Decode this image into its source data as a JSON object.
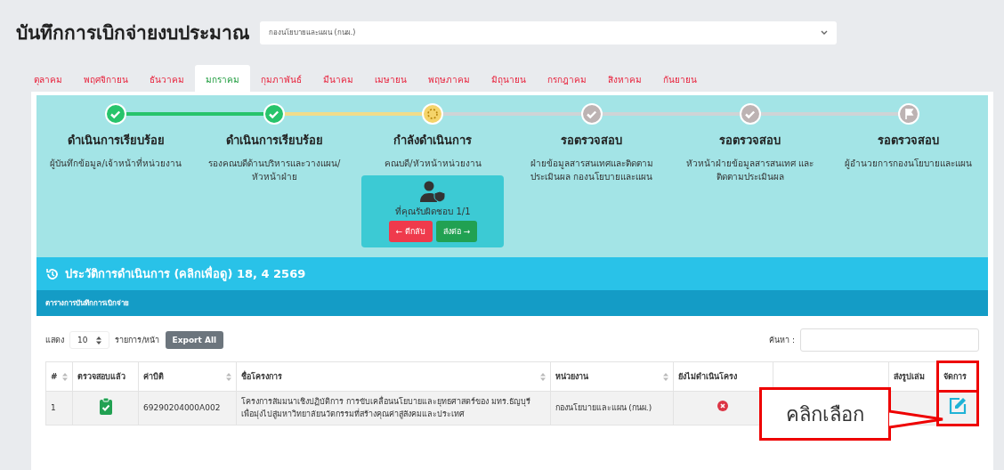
{
  "page": {
    "title": "บันทึกการเบิกจ่ายงบประมาณ",
    "department_select": "กองนโยบายและแผน (กนผ.)"
  },
  "month_tabs": [
    {
      "label": "ตุลาคม",
      "selected": false
    },
    {
      "label": "พฤศจิกายน",
      "selected": false
    },
    {
      "label": "ธันวาคม",
      "selected": false
    },
    {
      "label": "มกราคม",
      "selected": true
    },
    {
      "label": "กุมภาพันธ์",
      "selected": false
    },
    {
      "label": "มีนาคม",
      "selected": false
    },
    {
      "label": "เมษายน",
      "selected": false
    },
    {
      "label": "พฤษภาคม",
      "selected": false
    },
    {
      "label": "มิถุนายน",
      "selected": false
    },
    {
      "label": "กรกฎาคม",
      "selected": false
    },
    {
      "label": "สิงหาคม",
      "selected": false
    },
    {
      "label": "กันยายน",
      "selected": false
    }
  ],
  "steps": [
    {
      "kind": "done",
      "title": "ดำเนินการเรียบร้อย",
      "role": "ผู้บันทึกข้อมูล/เจ้าหน้าที่หน่วยงาน"
    },
    {
      "kind": "done",
      "title": "ดำเนินการเรียบร้อย",
      "role": "รองคณบดีด้านบริหารและวางแผน/หัวหน้าฝ่าย"
    },
    {
      "kind": "current",
      "title": "กำลังดำเนินการ",
      "role": "คณบดี/หัวหน้าหน่วยงาน",
      "task_card": {
        "text": "ที่คุณรับผิดชอบ 1/1",
        "reject_button": "← ตีกลับ",
        "forward_button": "ส่งต่อ →"
      }
    },
    {
      "kind": "pending",
      "title": "รอตรวจสอบ",
      "role": "ฝ่ายข้อมูลสารสนเทศและติดตามประเมินผล กองนโยบายและแผน"
    },
    {
      "kind": "pending",
      "title": "รอตรวจสอบ",
      "role": "หัวหน้าฝ่ายข้อมูลสารสนเทศ และติดตามประเมินผล"
    },
    {
      "kind": "final",
      "title": "รอตรวจสอบ",
      "role": "ผู้อำนวยการกองนโยบายและแผน"
    }
  ],
  "history_bar": {
    "text": "ประวัติการดำเนินการ (คลิกเพื่อดู) 18, 4 2569"
  },
  "table_section": {
    "title": "ตารางการบันทึกการเบิกจ่าย"
  },
  "controls": {
    "show_label": "แสดง",
    "page_size": "10",
    "per_page_label": "รายการ/หน้า",
    "export_button": "Export All",
    "search_label": "ค้นหา :"
  },
  "table": {
    "columns": [
      {
        "label": "#",
        "sortable": true,
        "highlighted": false
      },
      {
        "label": "ตรวจสอบแล้ว",
        "sortable": false,
        "highlighted": false
      },
      {
        "label": "ค่าบิติ",
        "sortable": true,
        "highlighted": false
      },
      {
        "label": "ชื่อโครงการ",
        "sortable": true,
        "highlighted": false
      },
      {
        "label": "หน่วยงาน",
        "sortable": true,
        "highlighted": false
      },
      {
        "label": "ยังไม่ดำเนินโครง",
        "sortable": false,
        "highlighted": false
      },
      {
        "label": "ส่งรูปเล่ม",
        "sortable": false,
        "highlighted": false
      },
      {
        "label": "จัดการ",
        "sortable": false,
        "highlighted": true
      }
    ],
    "rows": [
      {
        "number": "1",
        "checked": true,
        "code": "69290204000A002",
        "project": "โครงการสัมมนาเชิงปฏิบัติการ การขับเคลื่อนนโยบายและยุทธศาสตร์ของ มทร.ธัญบุรี เพื่อมุ่งไปสู่มหาวิทยาลัยนวัตกรรมที่สร้างคุณค่าสู่สังคมและประเทศ",
        "unit": "กองนโยบายและแผน (กนผ.)",
        "not_started": true
      }
    ]
  },
  "callout": {
    "text": "คลิกเลือก"
  }
}
